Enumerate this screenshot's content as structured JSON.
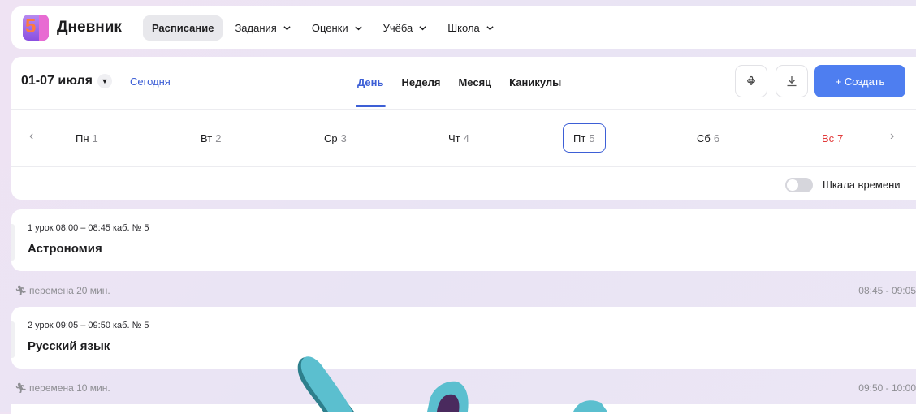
{
  "app": {
    "logo_glyph": "5",
    "title": "Дневник"
  },
  "nav": [
    {
      "label": "Расписание",
      "active": true,
      "dropdown": false
    },
    {
      "label": "Задания",
      "active": false,
      "dropdown": true
    },
    {
      "label": "Оценки",
      "active": false,
      "dropdown": true
    },
    {
      "label": "Учёба",
      "active": false,
      "dropdown": true
    },
    {
      "label": "Школа",
      "active": false,
      "dropdown": true
    }
  ],
  "toolbar": {
    "range": "01-07 июля",
    "today": "Сегодня",
    "tabs": [
      "День",
      "Неделя",
      "Месяц",
      "Каникулы"
    ],
    "active_tab": "День",
    "create_label": "+ Создать",
    "icons": [
      "flower-settings-icon",
      "download-icon"
    ]
  },
  "week": {
    "days": [
      {
        "name": "Пн",
        "num": "1"
      },
      {
        "name": "Вт",
        "num": "2"
      },
      {
        "name": "Ср",
        "num": "3"
      },
      {
        "name": "Чт",
        "num": "4"
      },
      {
        "name": "Пт",
        "num": "5",
        "selected": true
      },
      {
        "name": "Сб",
        "num": "6"
      },
      {
        "name": "Вс",
        "num": "7",
        "weekend": true
      }
    ]
  },
  "timescale": {
    "label": "Шкала времени",
    "enabled": false
  },
  "schedule": [
    {
      "meta": "1 урок 08:00 – 08:45 каб. № 5",
      "subject": "Астрономия"
    },
    {
      "break": "перемена 20 мин.",
      "time": "08:45 - 09:05"
    },
    {
      "meta": "2 урок 09:05 – 09:50 каб. № 5",
      "subject": "Русский язык"
    },
    {
      "break": "перемена 10 мин.",
      "time": "09:50 - 10:00"
    }
  ],
  "colors": {
    "accent": "#3d5fd6",
    "create": "#4e7ef0",
    "weekend": "#e23b3b"
  }
}
